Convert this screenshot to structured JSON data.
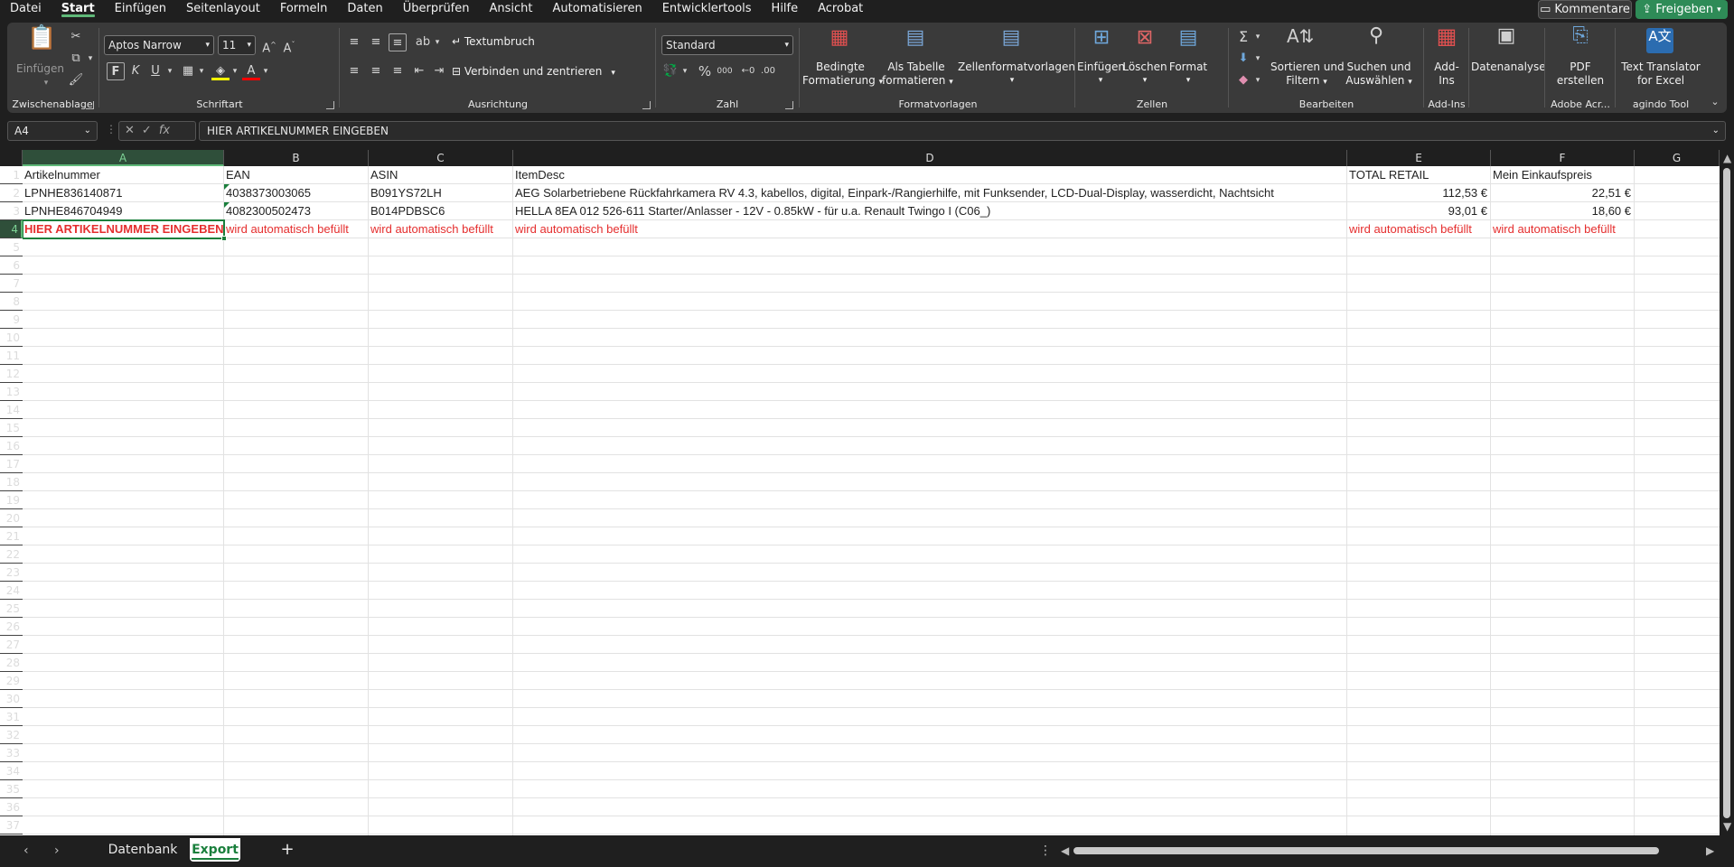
{
  "menu": {
    "items": [
      "Datei",
      "Start",
      "Einfügen",
      "Seitenlayout",
      "Formeln",
      "Daten",
      "Überprüfen",
      "Ansicht",
      "Automatisieren",
      "Entwicklertools",
      "Hilfe",
      "Acrobat"
    ],
    "active": "Start",
    "comments_label": "Kommentare",
    "share_label": "Freigeben"
  },
  "ribbon": {
    "clipboard": {
      "paste_label": "Einfügen",
      "group": "Zwischenablage"
    },
    "font": {
      "name": "Aptos Narrow",
      "size": "11",
      "bold": "F",
      "italic": "K",
      "underline": "U",
      "group": "Schriftart"
    },
    "alignment": {
      "wrap_label": "Textumbruch",
      "merge_label": "Verbinden und zentrieren",
      "group": "Ausrichtung"
    },
    "number": {
      "format": "Standard",
      "group": "Zahl"
    },
    "styles": {
      "conditional_l1": "Bedingte",
      "conditional_l2": "Formatierung",
      "table_l1": "Als Tabelle",
      "table_l2": "formatieren",
      "cellstyles": "Zellenformatvorlagen",
      "group": "Formatvorlagen"
    },
    "cells": {
      "insert": "Einfügen",
      "delete": "Löschen",
      "format": "Format",
      "group": "Zellen"
    },
    "editing": {
      "sort_l1": "Sortieren und",
      "sort_l2": "Filtern",
      "find_l1": "Suchen und",
      "find_l2": "Auswählen",
      "group": "Bearbeiten"
    },
    "addins": {
      "l1": "Add-",
      "l2": "Ins",
      "group": "Add-Ins"
    },
    "analysis": {
      "label": "Datenanalyse"
    },
    "adobe": {
      "l1": "PDF",
      "l2": "erstellen",
      "group": "Adobe Acr..."
    },
    "agindo": {
      "l1": "Text Translator",
      "l2": "for Excel",
      "group": "agindo Tool"
    }
  },
  "formulabar": {
    "namebox": "A4",
    "fx": "fx",
    "content": "HIER ARTIKELNUMMER EINGEBEN"
  },
  "sheet": {
    "columns": [
      "A",
      "B",
      "C",
      "D",
      "E",
      "F",
      "G"
    ],
    "selected_col": "A",
    "selected_row": 4,
    "row_numbers": [
      "1",
      "2",
      "3",
      "4",
      "5",
      "6",
      "7",
      "8",
      "9",
      "10",
      "11",
      "12",
      "13",
      "14",
      "15",
      "16",
      "17",
      "18",
      "19",
      "20",
      "21",
      "22",
      "23",
      "24",
      "25",
      "26",
      "27",
      "28",
      "29",
      "30",
      "31",
      "32",
      "33",
      "34",
      "35",
      "36",
      "37"
    ],
    "header": {
      "a": "Artikelnummer",
      "b": "EAN",
      "c": "ASIN",
      "d": "ItemDesc",
      "e": "TOTAL RETAIL",
      "f": "Mein Einkaufspreis"
    },
    "row2": {
      "a": "LPNHE836140871",
      "b": "4038373003065",
      "c": "B091YS72LH",
      "d": "AEG Solarbetriebene Rückfahrkamera RV 4.3, kabellos, digital, Einpark-/Rangierhilfe, mit Funksender, LCD-Dual-Display, wasserdicht, Nachtsicht",
      "e": "112,53 €",
      "f": "22,51 €"
    },
    "row3": {
      "a": "LPNHE846704949",
      "b": "4082300502473",
      "c": "B014PDBSC6",
      "d": "HELLA 8EA 012 526-611 Starter/Anlasser - 12V - 0.85kW - für u.a. Renault Twingo I (C06_)",
      "e": "93,01 €",
      "f": "18,60 €"
    },
    "row4": {
      "a": "HIER ARTIKELNUMMER EINGEBEN",
      "b": "wird automatisch befüllt",
      "c": "wird automatisch befüllt",
      "d": "wird automatisch befüllt",
      "e": "wird automatisch befüllt",
      "f": "wird automatisch befüllt"
    }
  },
  "tabs": {
    "items": [
      "Datenbank",
      "Export"
    ],
    "active": "Export",
    "add": "+"
  },
  "colors": {
    "accent": "#1a7f3c",
    "red_text": "#e52e2e",
    "share": "#2e8b57"
  }
}
